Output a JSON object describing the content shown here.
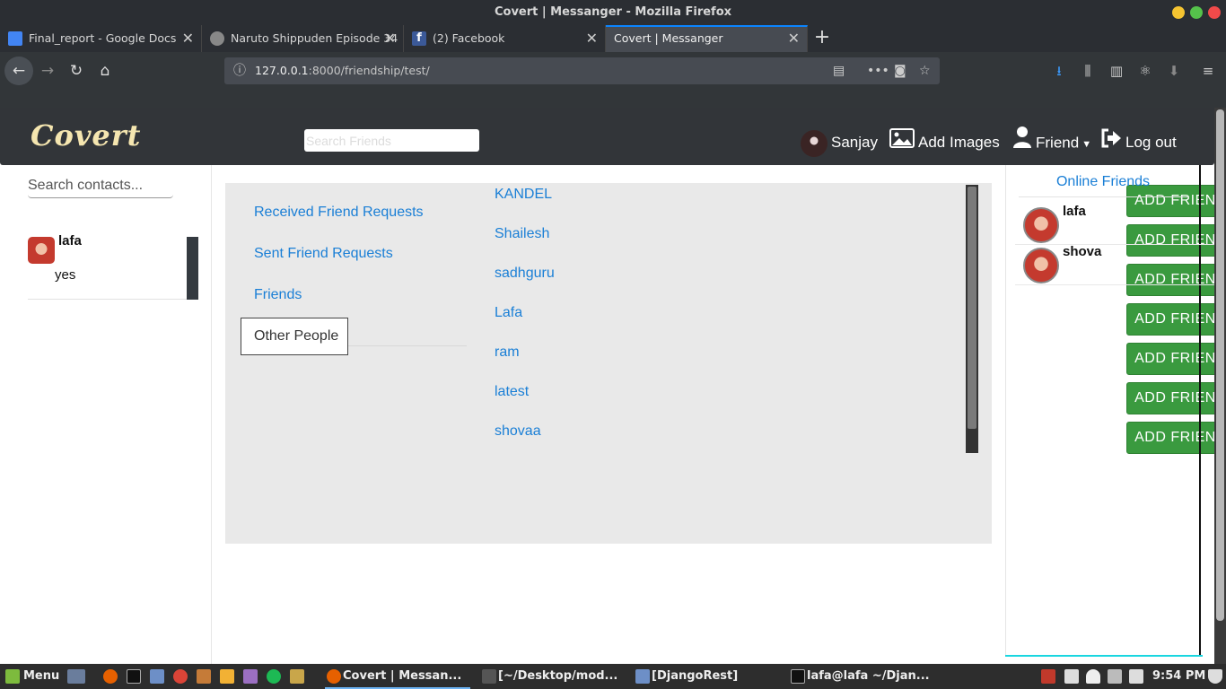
{
  "window": {
    "title": "Covert | Messanger - Mozilla Firefox"
  },
  "tabs": [
    {
      "label": "Final_report - Google Docs",
      "color": "#4285f4"
    },
    {
      "label": "Naruto Shippuden Episode 34",
      "color": "#888888"
    },
    {
      "label": "(2) Facebook",
      "color": "#3b5998"
    },
    {
      "label": "Covert | Messanger",
      "color": "#474b52"
    }
  ],
  "url": {
    "host": "127.0.0.1",
    "rest": ":8000/friendship/test/"
  },
  "app": {
    "logo": "Covert",
    "search_placeholder": "Search Friends",
    "user": "Sanjay",
    "add_images": "Add Images",
    "friend": "Friend",
    "logout": "Log out"
  },
  "contacts": {
    "search_placeholder": "Search contacts...",
    "items": [
      {
        "name": "lafa",
        "message": "yes"
      }
    ]
  },
  "menu": {
    "items": [
      "Received Friend Requests",
      "Sent Friend Requests",
      "Friends",
      "Other People"
    ],
    "active": "Other People"
  },
  "people": {
    "button_label": "ADD FRIEND",
    "names": [
      "KANDEL",
      "Shailesh",
      "sadhguru",
      "Lafa",
      "ram",
      "latest",
      "shovaa"
    ]
  },
  "online": {
    "title": "Online Friends",
    "friends": [
      "lafa",
      "shova"
    ]
  },
  "taskbar": {
    "menu": "Menu",
    "tasks": [
      "Covert | Messan...",
      "[~/Desktop/mod...",
      "[DjangoRest]",
      "lafa@lafa ~/Djan..."
    ],
    "clock": "9:54 PM"
  },
  "colors": {
    "accent": "#1a7fd6",
    "button_green": "#3a9a3f",
    "navbar": "#323539"
  }
}
